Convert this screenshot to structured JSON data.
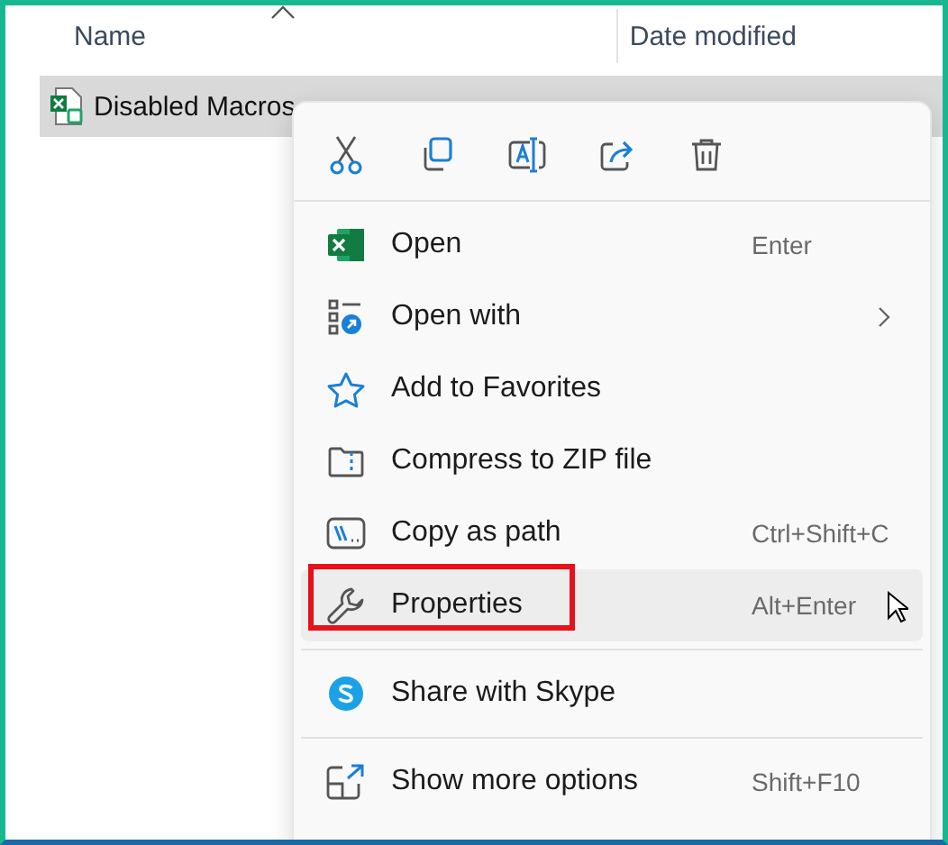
{
  "columns": [
    {
      "label": "Name",
      "sorted": true
    },
    {
      "label": "Date modified",
      "sorted": false
    }
  ],
  "file": {
    "name": "Disabled Macros",
    "selected": true
  },
  "menu": {
    "groups": [
      [
        {
          "label": "Open",
          "shortcut": "Enter",
          "submenu": false,
          "hovered": false,
          "highlighted": false
        },
        {
          "label": "Open with",
          "submenu": true,
          "hovered": false,
          "highlighted": false
        },
        {
          "label": "Add to Favorites",
          "submenu": false,
          "hovered": false,
          "highlighted": false
        },
        {
          "label": "Compress to ZIP file",
          "submenu": false,
          "hovered": false,
          "highlighted": false
        },
        {
          "label": "Copy as path",
          "shortcut": "Ctrl+Shift+C",
          "submenu": false,
          "hovered": false,
          "highlighted": false
        },
        {
          "label": "Properties",
          "shortcut": "Alt+Enter",
          "submenu": false,
          "hovered": true,
          "highlighted": true
        }
      ],
      [
        {
          "label": "Share with Skype",
          "submenu": false,
          "hovered": false,
          "highlighted": false
        }
      ],
      [
        {
          "label": "Show more options",
          "shortcut": "Shift+F10",
          "submenu": false,
          "hovered": false,
          "highlighted": false
        }
      ]
    ]
  }
}
